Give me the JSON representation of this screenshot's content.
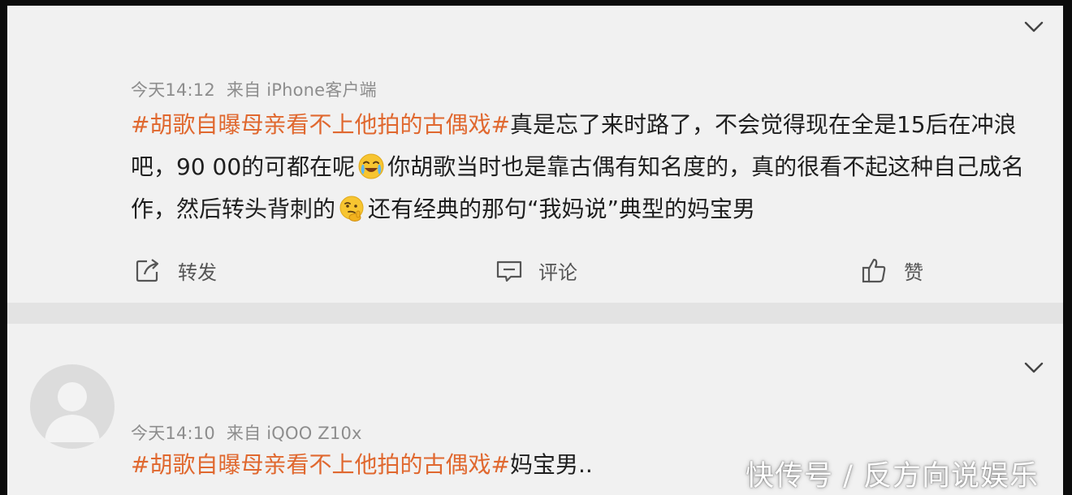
{
  "posts": [
    {
      "time": "今天14:12",
      "source": "来自 iPhone客户端",
      "hashtag": "#胡歌自曝母亲看不上他拍的古偶戏#",
      "text_1": "真是忘了来时路了，不会觉得现在全是15后在冲浪吧，90 00的可都在呢",
      "emoji_1": "crying-laughing-emoji",
      "text_2": "你胡歌当时也是靠古偶有知名度的，真的很看不起这种自己成名作，然后转头背刺的",
      "emoji_2": "thinking-emoji",
      "text_3": "还有经典的那句“我妈说”典型的妈宝男",
      "actions": {
        "forward_label": "转发",
        "comment_label": "评论",
        "like_label": "赞"
      }
    },
    {
      "time": "今天14:10",
      "source": "来自 iQOO Z10x",
      "hashtag": "#胡歌自曝母亲看不上他拍的古偶戏#",
      "text_1": "妈宝男.."
    }
  ],
  "watermark": "快传号 / 反方向说娱乐",
  "colors": {
    "background": "#f1f1f1",
    "hashtag": "#e0682f",
    "meta_text": "#8d8d8d",
    "body_text": "#1f1f1f",
    "separator": "#e3e3e3",
    "border": "#0c0c0c"
  },
  "icons": [
    "chevron-down-icon",
    "forward-icon",
    "comment-icon",
    "like-icon",
    "avatar-placeholder-icon"
  ]
}
